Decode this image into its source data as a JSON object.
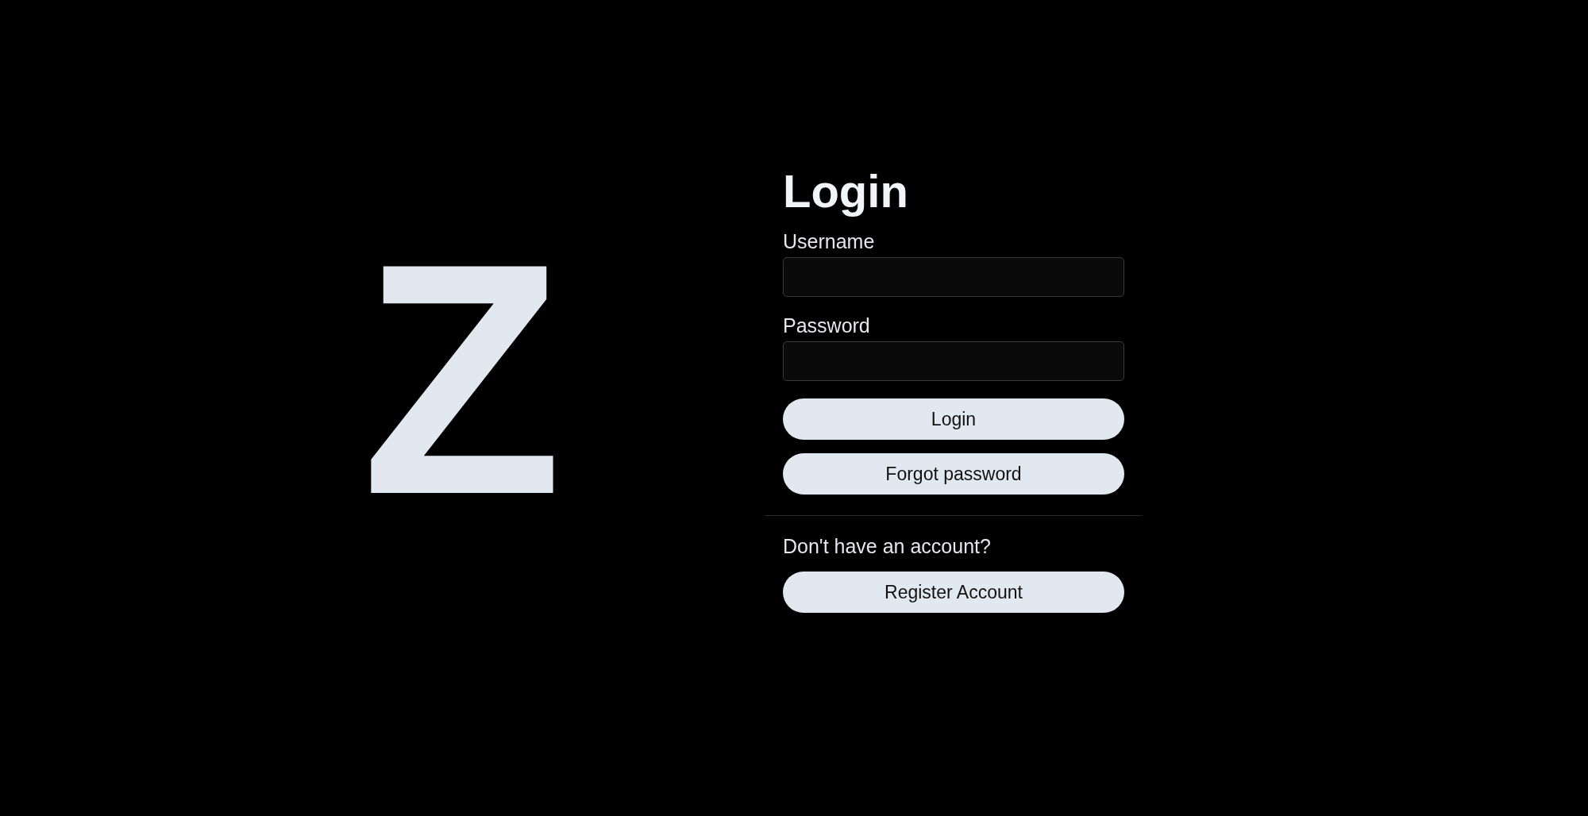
{
  "logo": {
    "text": "Z"
  },
  "form": {
    "title": "Login",
    "fields": [
      {
        "label": "Username"
      },
      {
        "label": "Password"
      }
    ],
    "buttons": [
      "Login",
      "Forgot password"
    ],
    "register_prompt": "Don't have an account?",
    "register_button": "Register Account"
  }
}
